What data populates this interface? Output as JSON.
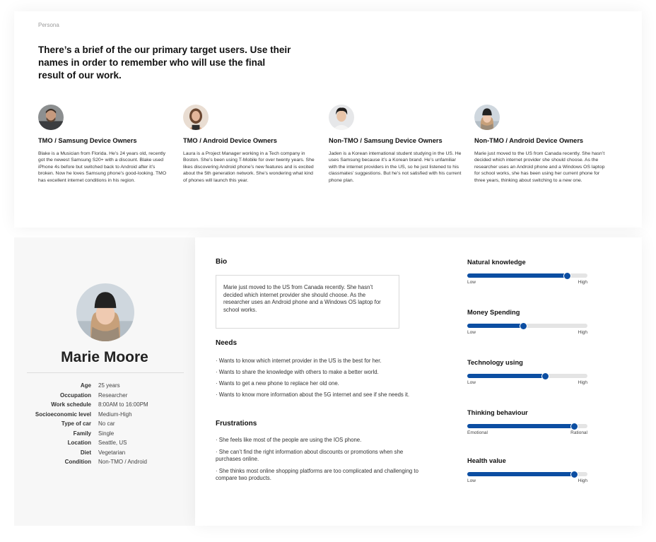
{
  "header": {
    "eyebrow": "Persona",
    "headline": "There’s a brief of the our primary target users. Use their names in order to remember who will use the final result of our work."
  },
  "personas": [
    {
      "avatar_icon": "person-avatar-male-beard",
      "title": "TMO / Samsung Device Owners",
      "description": "Blake is a Musician from Florida. He’s 24 years old, recently got the newest Samsung S20+ with a discount. Blake used iPhone 4s before but switched back to Android after it’s broken. Now he loves Samsung phone’s good-looking. TMO has excellent internet conditions in his region."
    },
    {
      "avatar_icon": "person-avatar-female",
      "title": "TMO / Android Device Owners",
      "description": "Laura is a Project Manager working in a Tech company in Boston. She’s been using T-Mobile for over twenty years. She likes discovering Android phone’s new features and is excited about the 5th generation network. She’s wondering what kind of phones will launch this year."
    },
    {
      "avatar_icon": "person-avatar-male-student",
      "title": "Non-TMO / Samsung Device Owners",
      "description": "Jaden is a Korean international student studying in the US. He uses Samsung because it’s a Korean brand. He’s unfamiliar with the internet providers in the US, so he just listened to his classmates’ suggestions. But he’s not satisfied with his current phone plan."
    },
    {
      "avatar_icon": "person-avatar-female-beanie",
      "title": "Non-TMO / Android Device Owners",
      "description": "Marie just moved to the US from Canada recently. She hasn’t decided which internet provider she should choose. As the researcher uses an Android phone and a Windows OS laptop for school works, she has been using her current phone for three years, thinking about switching to a new one."
    }
  ],
  "profile": {
    "avatar_icon": "person-avatar-female-beanie",
    "name": "Marie Moore",
    "attributes": [
      {
        "key": "Age",
        "value": "25 years"
      },
      {
        "key": "Occupation",
        "value": "Researcher"
      },
      {
        "key": "Work schedule",
        "value": "8:00AM to 16:00PM"
      },
      {
        "key": "Socioeconomic level",
        "value": "Medium-High"
      },
      {
        "key": "Type of car",
        "value": "No car"
      },
      {
        "key": "Family",
        "value": "Single"
      },
      {
        "key": "Location",
        "value": "Seattle, US"
      },
      {
        "key": "Diet",
        "value": "Vegetarian"
      },
      {
        "key": "Condition",
        "value": "Non-TMO / Android"
      }
    ]
  },
  "bio": {
    "title": "Bio",
    "text": "Marie just moved to the US from Canada recently. She hasn’t decided which internet provider she should choose. As the researcher uses an Android phone and a Windows OS laptop for school works."
  },
  "needs": {
    "title": "Needs",
    "items": [
      "· Wants to know which internet provider in the US is the best for her.",
      "· Wants to share the knowledge with others to make a better world.",
      "· Wants to get a new phone to replace her old one.",
      "· Wants to know more information about the 5G internet and see if she needs it."
    ]
  },
  "frustrations": {
    "title": "Frustrations",
    "items": [
      "·  She feels like most of the people are using the IOS phone.",
      "· She can’t find the right information about discounts or promotions when she purchases online.",
      "· She thinks most online shopping platforms are too complicated and challenging to compare two products."
    ]
  },
  "scales": [
    {
      "title": "Natural knowledge",
      "low": "Low",
      "high": "High",
      "value": 0.83
    },
    {
      "title": "Money Spending",
      "low": "Low",
      "high": "High",
      "value": 0.47
    },
    {
      "title": "Technology using",
      "low": "Low",
      "high": "High",
      "value": 0.65
    },
    {
      "title": "Thinking behaviour",
      "low": "Emotional",
      "high": "Rational",
      "value": 0.89
    },
    {
      "title": "Health value",
      "low": "Low",
      "high": "High",
      "value": 0.89
    }
  ],
  "colors": {
    "accent": "#0c4ea2",
    "track": "#e4e4e4"
  }
}
